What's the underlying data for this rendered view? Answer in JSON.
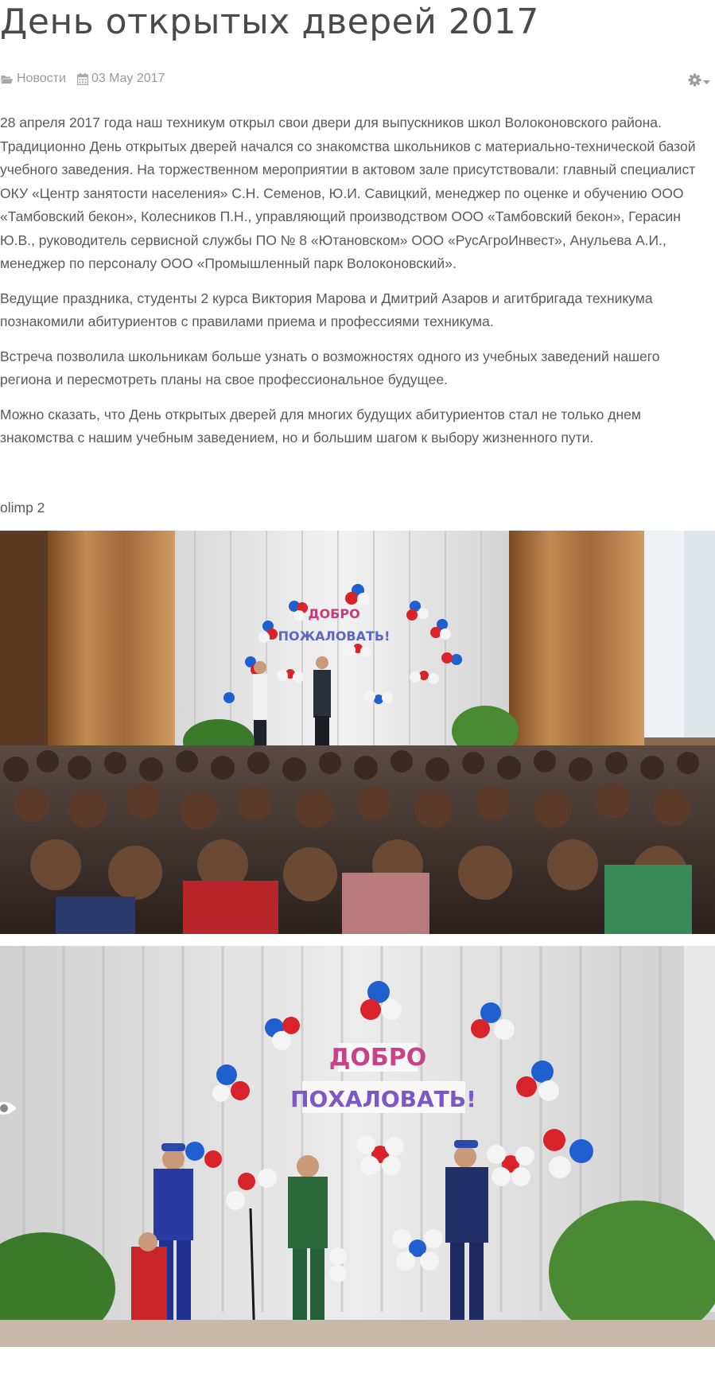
{
  "article": {
    "title": "День открытых дверей 2017",
    "category": "Новости",
    "date": "03 May 2017",
    "paragraphs": [
      "28 апреля 2017 года наш техникум открыл свои двери для выпускников школ Волоконовского района. Традиционно День открытых дверей начался со знакомства школьников с материально-технической базой учебного заведения. На торжественном мероприятии в актовом зале присутствовали: главный специалист ОКУ «Центр занятости населения» С.Н. Семенов, Ю.И. Савицкий, менеджер по оценке и обучению ООО «Тамбовский бекон», Колесников П.Н., управляющий производством ООО «Тамбовский бекон», Герасин Ю.В., руководитель сервисной службы ПО № 8 «Ютановском» ООО «РусАгроИнвест», Анульева А.И., менеджер по персоналу ООО «Промышленный парк Волоконовский».",
      "Ведущие праздника, студенты 2 курса Виктория Марова и Дмитрий Азаров и агитбригада техникума познакомили абитуриентов с правилами приема и профессиями техникума.",
      "Встреча позволила школьникам больше узнать о возможностях одного из учебных заведений нашего региона и пересмотреть планы на свое профессиональное будущее.",
      "Можно сказать, что День открытых дверей для многих будущих абитуриентов стал не только днем знакомства с нашим учебным заведением, но и большим шагом к выбору жизненного пути."
    ],
    "image_caption": "olimp 2",
    "banner_line1": "ДОБРО",
    "banner_line2": "ПОЖАЛОВАТЬ!",
    "banner_line2_b": "ПОХАЛОВАТЬ!"
  },
  "icons": {
    "category": "folder-open-icon",
    "date": "calendar-icon",
    "settings": "gear-icon",
    "settings_caret": "caret-down-icon",
    "view": "eye-icon"
  },
  "colors": {
    "title": "#4a4a4a",
    "body_text": "#5a5a5a",
    "meta": "#9a9a9a",
    "balloon_red": "#d8232a",
    "balloon_blue": "#1f5fd0",
    "balloon_white": "#f4f4f4",
    "curtain_brown": "#b07a48"
  }
}
